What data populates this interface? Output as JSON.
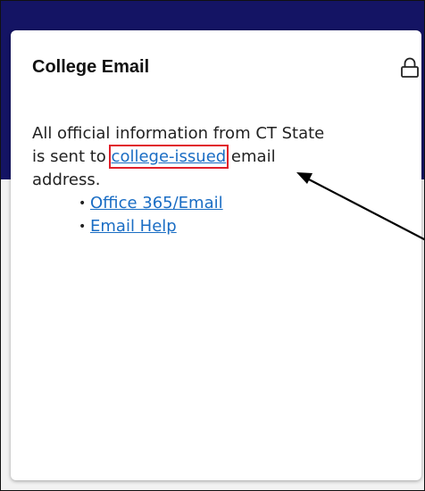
{
  "card": {
    "title": "College Email",
    "lock_icon": "lock-icon",
    "body": {
      "line1": "All official information from CT State",
      "line2_prefix": "is sent to ",
      "link_text": "college-issued",
      "line2_suffix": " email",
      "line3": "address."
    },
    "links": [
      {
        "label": "Office 365/Email"
      },
      {
        "label": "Email Help"
      }
    ]
  },
  "colors": {
    "header_band": "#141464",
    "link": "#1a6dc4",
    "highlight_box": "#e0202a"
  }
}
